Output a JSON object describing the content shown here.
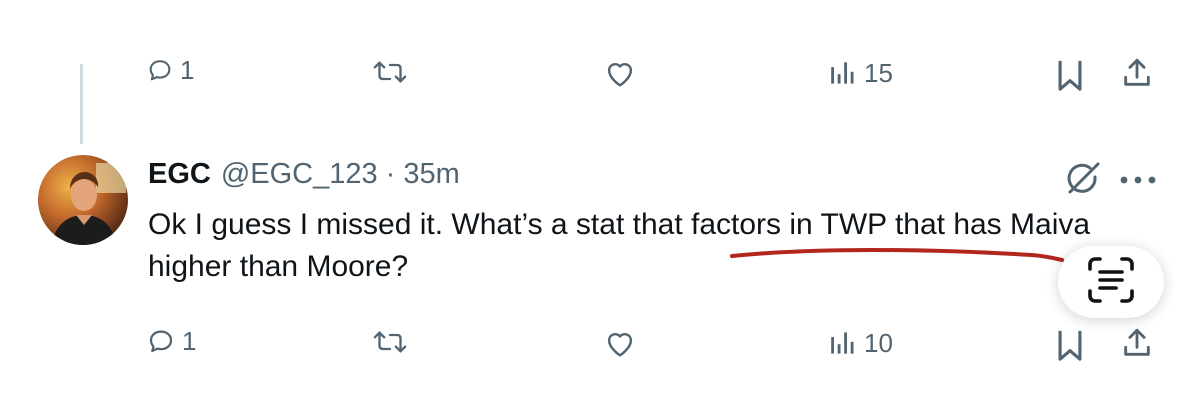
{
  "top_actions": {
    "replies": "1",
    "reposts": "",
    "likes": "",
    "views": "15"
  },
  "tweet": {
    "display_name": "EGC",
    "handle": "@EGC_123",
    "separator": "·",
    "time": "35m",
    "text": "Ok I guess I missed it. What’s a stat that factors in TWP that has Maiva higher than Moore?",
    "actions": {
      "replies": "1",
      "reposts": "",
      "likes": "",
      "views": "10"
    }
  },
  "colors": {
    "text_primary": "#0f1419",
    "text_secondary": "#536471",
    "thread_line": "#cfd9de",
    "annotation_underline": "#b3261e"
  },
  "icons": [
    "reply-icon",
    "repost-icon",
    "like-icon",
    "views-icon",
    "bookmark-icon",
    "share-icon",
    "grok-icon",
    "more-icon",
    "text-scan-icon"
  ]
}
